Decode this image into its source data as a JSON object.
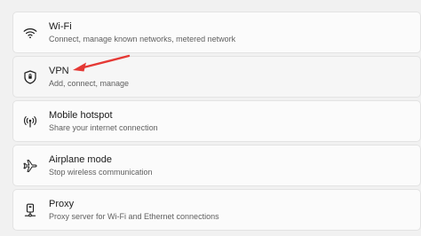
{
  "settings": {
    "items": [
      {
        "icon": "wifi-icon",
        "title": "Wi-Fi",
        "subtitle": "Connect, manage known networks, metered network"
      },
      {
        "icon": "vpn-shield-icon",
        "title": "VPN",
        "subtitle": "Add, connect, manage"
      },
      {
        "icon": "mobile-hotspot-icon",
        "title": "Mobile hotspot",
        "subtitle": "Share your internet connection"
      },
      {
        "icon": "airplane-icon",
        "title": "Airplane mode",
        "subtitle": "Stop wireless communication"
      },
      {
        "icon": "proxy-icon",
        "title": "Proxy",
        "subtitle": "Proxy server for Wi-Fi and Ethernet connections"
      }
    ]
  },
  "annotation": {
    "arrow_color": "#e53935"
  }
}
